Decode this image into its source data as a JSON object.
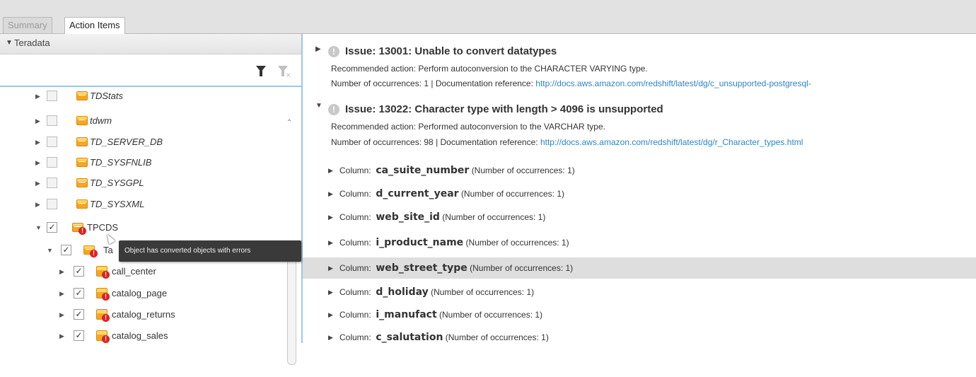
{
  "tabs": [
    "Summary",
    "Action Items"
  ],
  "tree": {
    "header": "Teradata",
    "items": [
      {
        "label": "TDStats"
      },
      {
        "label": "tdwm"
      },
      {
        "label": "TD_SERVER_DB"
      },
      {
        "label": "TD_SYSFNLIB"
      },
      {
        "label": "TD_SYSGPL"
      },
      {
        "label": "TD_SYSXML"
      },
      {
        "label": "TPCDS"
      },
      {
        "label": "Ta"
      },
      {
        "label": "call_center"
      },
      {
        "label": "catalog_page"
      },
      {
        "label": "catalog_returns"
      },
      {
        "label": "catalog_sales"
      }
    ],
    "tooltip": "Object has converted objects with errors"
  },
  "issues": [
    {
      "title": "Issue: 13001: Unable to convert datatypes",
      "action": "Recommended action: Perform autoconversion to the CHARACTER VARYING type.",
      "occurrences": "Number of occurrences: 1 | Documentation reference: ",
      "link": "http://docs.aws.amazon.com/redshift/latest/dg/c_unsupported-postgresql-"
    },
    {
      "title": "Issue: 13022: Character type with length > 4096 is unsupported",
      "action": "Recommended action: Performed autoconversion to the VARCHAR type.",
      "occurrences": "Number of occurrences: 98 | Documentation reference: ",
      "link": "http://docs.aws.amazon.com/redshift/latest/dg/r_Character_types.html"
    }
  ],
  "columns": {
    "prefix": "Column:",
    "items": [
      {
        "name": "ca_suite_number",
        "count": "(Number of occurrences: 1)"
      },
      {
        "name": "d_current_year",
        "count": "(Number of occurrences: 1)"
      },
      {
        "name": "web_site_id",
        "count": "(Number of occurrences: 1)"
      },
      {
        "name": "i_product_name",
        "count": "(Number of occurrences: 1)"
      },
      {
        "name": "web_street_type",
        "count": "(Number of occurrences: 1)"
      },
      {
        "name": "d_holiday",
        "count": "(Number of occurrences: 1)"
      },
      {
        "name": "i_manufact",
        "count": "(Number of occurrences: 1)"
      },
      {
        "name": "c_salutation",
        "count": "(Number of occurrences: 1)"
      }
    ]
  }
}
